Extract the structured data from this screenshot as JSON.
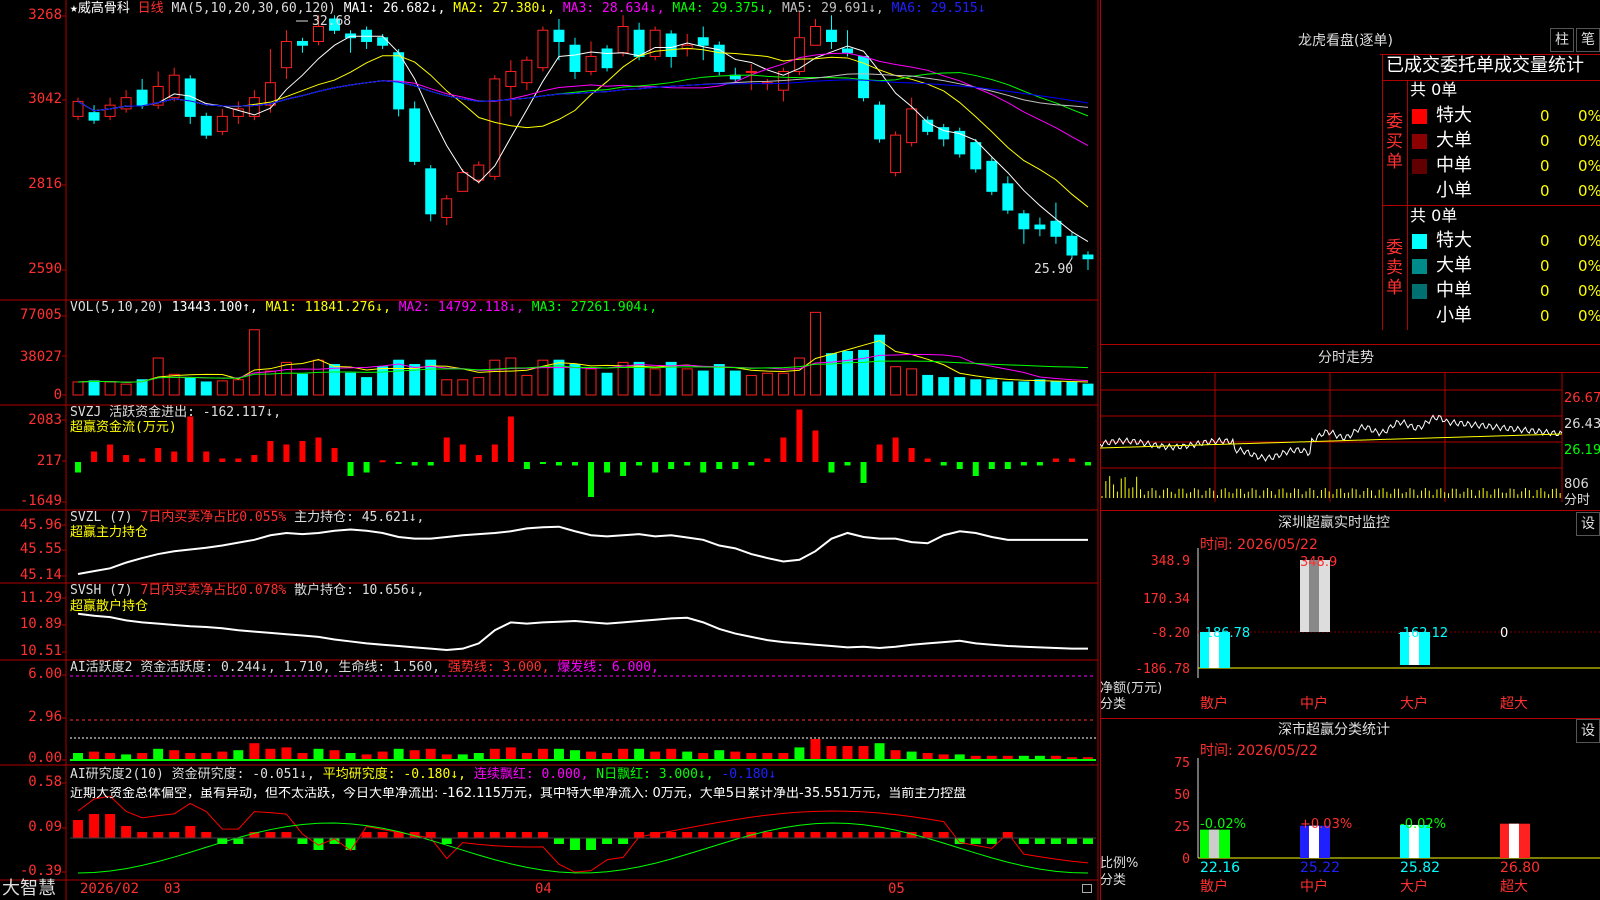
{
  "colors": {
    "up": "#ff2020",
    "down": "#00ffff",
    "ma1": "#ffffff",
    "ma2": "#ffff00",
    "ma3": "#ff00ff",
    "ma4": "#00ff00",
    "ma5": "#c0c0c0",
    "ma6": "#0000ff",
    "green": "#00ff00",
    "grid": "#b00000"
  },
  "main": {
    "title": "★威高骨科",
    "period": "日线",
    "ma_label": "MA(5,10,20,30,60,120)",
    "ma_items": [
      {
        "text": "MA1: 26.682↓,",
        "color": "#ffffff"
      },
      {
        "text": "MA2: 27.380↓,",
        "color": "#ffff00"
      },
      {
        "text": "MA3: 28.634↓,",
        "color": "#ff00ff"
      },
      {
        "text": "MA4: 29.375↓,",
        "color": "#00ff00"
      },
      {
        "text": "MA5: 29.691↓,",
        "color": "#c0c0c0"
      },
      {
        "text": "MA6: 29.515↓",
        "color": "#2020ff"
      }
    ],
    "axis": [
      "3268",
      "3042",
      "2816",
      "2590"
    ],
    "high_label": "32.68",
    "low_label": "25.90"
  },
  "chart_data": {
    "type": "candlestick",
    "candles": [
      [
        30.0,
        30.4,
        29.9,
        30.5
      ],
      [
        30.1,
        29.9,
        29.8,
        30.3
      ],
      [
        30.0,
        30.3,
        29.9,
        30.5
      ],
      [
        30.2,
        30.5,
        30.1,
        30.7
      ],
      [
        30.7,
        30.3,
        30.2,
        31.0
      ],
      [
        30.3,
        30.8,
        30.2,
        31.2
      ],
      [
        30.5,
        31.1,
        30.4,
        31.3
      ],
      [
        31.0,
        30.0,
        29.8,
        31.1
      ],
      [
        30.0,
        29.5,
        29.4,
        30.1
      ],
      [
        29.6,
        30.0,
        29.5,
        30.2
      ],
      [
        30.0,
        30.2,
        29.8,
        30.4
      ],
      [
        30.0,
        30.5,
        29.9,
        30.7
      ],
      [
        30.3,
        30.9,
        30.1,
        31.8
      ],
      [
        31.3,
        32.0,
        31.0,
        32.3
      ],
      [
        32.0,
        31.9,
        31.7,
        32.1
      ],
      [
        32.0,
        32.4,
        31.9,
        32.7
      ],
      [
        32.6,
        32.3,
        32.2,
        32.7
      ],
      [
        32.2,
        32.1,
        31.7,
        32.3
      ],
      [
        32.3,
        32.0,
        31.8,
        32.4
      ],
      [
        32.1,
        31.9,
        31.8,
        32.2
      ],
      [
        31.7,
        30.2,
        30.0,
        31.8
      ],
      [
        30.2,
        28.8,
        28.7,
        30.4
      ],
      [
        28.6,
        27.4,
        27.2,
        28.7
      ],
      [
        27.3,
        27.8,
        27.1,
        27.9
      ],
      [
        28.0,
        28.5,
        28.0,
        28.6
      ],
      [
        28.3,
        28.7,
        28.2,
        28.8
      ],
      [
        28.4,
        31.0,
        28.3,
        31.1
      ],
      [
        30.8,
        31.2,
        30.0,
        31.5
      ],
      [
        30.9,
        31.5,
        30.7,
        31.6
      ],
      [
        31.3,
        32.3,
        31.2,
        32.4
      ],
      [
        32.3,
        32.0,
        31.5,
        32.6
      ],
      [
        31.9,
        31.2,
        31.0,
        32.1
      ],
      [
        31.2,
        31.6,
        31.1,
        32.0
      ],
      [
        31.8,
        31.3,
        31.2,
        31.9
      ],
      [
        31.7,
        32.4,
        31.6,
        32.7
      ],
      [
        32.3,
        31.6,
        31.5,
        32.5
      ],
      [
        31.6,
        32.3,
        31.5,
        32.4
      ],
      [
        32.2,
        31.6,
        31.3,
        32.3
      ],
      [
        31.8,
        31.9,
        31.6,
        32.2
      ],
      [
        32.1,
        31.9,
        31.5,
        32.4
      ],
      [
        31.9,
        31.2,
        31.1,
        32.0
      ],
      [
        31.1,
        31.0,
        30.9,
        31.3
      ],
      [
        31.2,
        31.2,
        30.7,
        31.4
      ],
      [
        30.9,
        30.9,
        30.7,
        31.0
      ],
      [
        30.7,
        31.2,
        30.4,
        31.3
      ],
      [
        31.2,
        32.1,
        31.1,
        32.8
      ],
      [
        31.9,
        32.4,
        31.9,
        32.6
      ],
      [
        32.3,
        32.0,
        31.8,
        32.7
      ],
      [
        31.8,
        31.7,
        31.6,
        32.3
      ],
      [
        31.6,
        30.5,
        30.4,
        31.0
      ],
      [
        30.3,
        29.4,
        29.3,
        30.4
      ],
      [
        28.5,
        29.5,
        28.4,
        29.6
      ],
      [
        29.3,
        30.2,
        29.2,
        30.5
      ],
      [
        29.9,
        29.6,
        29.5,
        30.0
      ],
      [
        29.7,
        29.4,
        29.2,
        29.8
      ],
      [
        29.6,
        29.0,
        28.9,
        29.7
      ],
      [
        29.3,
        28.6,
        28.5,
        29.4
      ],
      [
        28.8,
        28.0,
        27.9,
        28.9
      ],
      [
        28.2,
        27.5,
        27.4,
        28.4
      ],
      [
        27.4,
        27.0,
        26.6,
        27.5
      ],
      [
        27.1,
        27.0,
        26.8,
        27.3
      ],
      [
        27.2,
        26.8,
        26.6,
        27.7
      ],
      [
        26.8,
        26.3,
        26.2,
        26.9
      ],
      [
        26.3,
        26.2,
        25.9,
        26.4
      ]
    ],
    "volumes": [
      1.2,
      1.3,
      1.2,
      1.0,
      1.4,
      3.4,
      1.9,
      1.6,
      1.2,
      1.3,
      1.4,
      6.0,
      2.2,
      3.0,
      1.9,
      3.2,
      2.8,
      2.0,
      1.6,
      2.6,
      3.2,
      2.8,
      3.2,
      1.4,
      1.4,
      1.6,
      3.2,
      3.4,
      1.8,
      3.2,
      3.2,
      2.8,
      2.4,
      2.0,
      3.0,
      3.0,
      2.4,
      3.0,
      2.4,
      2.2,
      2.8,
      2.2,
      1.8,
      2.0,
      2.0,
      3.4,
      7.6,
      3.8,
      4.0,
      4.1,
      5.5,
      2.6,
      2.4,
      1.8,
      1.6,
      1.6,
      1.4,
      1.4,
      1.2,
      1.2,
      1.4,
      1.2,
      1.2,
      1.0
    ],
    "volume_axis": [
      "77005",
      "38027",
      "0"
    ],
    "svzj": [
      -0.3,
      0.3,
      0.5,
      0.2,
      0.1,
      0.4,
      0.3,
      1.3,
      0.3,
      0.1,
      0.1,
      0.2,
      0.6,
      0.5,
      0.6,
      0.7,
      0.4,
      -0.4,
      -0.3,
      0.05,
      -0.05,
      -0.1,
      -0.1,
      0.7,
      0.5,
      0.2,
      0.5,
      1.3,
      -0.2,
      -0.05,
      -0.1,
      -0.1,
      -1.0,
      -0.3,
      -0.4,
      -0.1,
      -0.3,
      -0.2,
      -0.1,
      -0.3,
      -0.2,
      -0.2,
      -0.1,
      0.1,
      0.7,
      1.5,
      0.9,
      -0.3,
      -0.1,
      -0.6,
      0.5,
      0.7,
      0.4,
      0.1,
      -0.1,
      -0.2,
      -0.4,
      -0.2,
      -0.2,
      -0.1,
      -0.1,
      0.1,
      0.1,
      -0.1
    ],
    "svzj_axis": [
      "2083",
      "217",
      "-1649"
    ],
    "svzl": [
      45.1,
      45.15,
      45.2,
      45.3,
      45.38,
      45.45,
      45.5,
      45.53,
      45.56,
      45.6,
      45.65,
      45.7,
      45.78,
      45.82,
      45.8,
      45.82,
      45.86,
      45.88,
      45.86,
      45.82,
      45.75,
      45.72,
      45.72,
      45.75,
      45.78,
      45.8,
      45.82,
      45.85,
      45.9,
      45.92,
      45.93,
      45.85,
      45.78,
      45.76,
      45.78,
      45.8,
      45.76,
      45.78,
      45.74,
      45.7,
      45.6,
      45.55,
      45.45,
      45.38,
      45.32,
      45.35,
      45.5,
      45.72,
      45.82,
      45.75,
      45.72,
      45.72,
      45.66,
      45.64,
      45.78,
      45.85,
      45.82,
      45.75,
      45.7,
      45.7,
      45.7,
      45.7,
      45.7,
      45.7
    ],
    "svzl_axis": [
      "45.96",
      "45.55",
      "45.14"
    ],
    "svsh": [
      11.05,
      11.02,
      11.0,
      10.95,
      10.92,
      10.9,
      10.88,
      10.86,
      10.85,
      10.83,
      10.8,
      10.78,
      10.76,
      10.74,
      10.72,
      10.7,
      10.66,
      10.63,
      10.6,
      10.58,
      10.56,
      10.54,
      10.52,
      10.5,
      10.52,
      10.6,
      10.8,
      10.92,
      10.9,
      10.92,
      10.93,
      10.94,
      10.92,
      10.9,
      10.92,
      10.94,
      10.96,
      10.98,
      10.99,
      10.92,
      10.82,
      10.75,
      10.7,
      10.65,
      10.62,
      10.6,
      10.58,
      10.56,
      10.54,
      10.55,
      10.53,
      10.55,
      10.58,
      10.6,
      10.62,
      10.64,
      10.6,
      10.58,
      10.56,
      10.55,
      10.54,
      10.53,
      10.52,
      10.52
    ],
    "svsh_axis": [
      "11.29",
      "10.89",
      "10.51"
    ],
    "ai_active": [
      0.5,
      0.6,
      0.5,
      0.4,
      0.5,
      0.8,
      0.7,
      0.5,
      0.5,
      0.6,
      0.7,
      1.2,
      0.8,
      0.9,
      0.5,
      0.8,
      0.7,
      0.5,
      0.4,
      0.6,
      0.8,
      0.7,
      0.8,
      0.4,
      0.4,
      0.5,
      0.8,
      0.9,
      0.5,
      0.8,
      0.8,
      0.7,
      0.6,
      0.5,
      0.8,
      0.8,
      0.6,
      0.8,
      0.6,
      0.5,
      0.7,
      0.6,
      0.5,
      0.5,
      0.5,
      0.9,
      1.5,
      1.0,
      1.0,
      1.0,
      1.2,
      0.7,
      0.6,
      0.5,
      0.4,
      0.4,
      0.3,
      0.3,
      0.3,
      0.3,
      0.3,
      0.3,
      0.2,
      0.2
    ],
    "ai_axis": [
      "6.00",
      "2.96",
      "0.00"
    ],
    "ai_research": [
      0.3,
      0.4,
      0.4,
      0.2,
      0.1,
      0.1,
      0.1,
      0.2,
      0.1,
      -0.1,
      -0.1,
      0.1,
      0.1,
      0.1,
      -0.1,
      -0.2,
      -0.1,
      -0.2,
      0.1,
      0.1,
      0.1,
      0.1,
      0.1,
      -0.1,
      0.1,
      0.1,
      0.1,
      0.1,
      0.1,
      0.1,
      -0.1,
      -0.2,
      -0.2,
      -0.1,
      -0.1,
      0.1,
      0.1,
      0.1,
      0.1,
      0.1,
      0.1,
      0.1,
      0.1,
      0.1,
      0.1,
      0.1,
      0.1,
      0.1,
      0.1,
      0.1,
      0.1,
      0.1,
      0.1,
      0.1,
      0.1,
      -0.1,
      -0.1,
      -0.1,
      0.1,
      -0.1,
      -0.1,
      -0.1,
      -0.1,
      -0.1
    ],
    "ai_research_axis": [
      "0.58",
      "0.09",
      "-0.39"
    ]
  },
  "panels": {
    "vol": {
      "label": "VOL(5,10,20)",
      "value": "13443.100↑,",
      "items": [
        {
          "text": "MA1: 11841.276↓,",
          "color": "#ffff00"
        },
        {
          "text": "MA2: 14792.118↓,",
          "color": "#ff00ff"
        },
        {
          "text": "MA3: 27261.904↓,",
          "color": "#00ff00"
        }
      ]
    },
    "svzj": {
      "label": "SVZJ  活跃资金进出: -162.117↓,",
      "sub": "超赢资金流(万元)"
    },
    "svzl": {
      "label": "SVZL (7)",
      "pct": "7日内买卖净占比0.055%",
      "hold": "主力持仓: 45.621↓,",
      "sub": "超赢主力持仓"
    },
    "svsh": {
      "label": "SVSH (7)",
      "pct": "7日内买卖净占比0.078%",
      "hold": "散户持仓: 10.656↓,",
      "sub": "超赢散户持仓"
    },
    "ai2": {
      "label": "AI活跃度2 资金活跃度: 0.244↓, 1.710, 生命线: 1.560,",
      "strong": "强势线: 3.000,",
      "burst": "爆发线: 6.000,"
    },
    "ai_r": {
      "label": "AI研究度2(10) 资金研究度: -0.051↓,",
      "avg": "平均研究度: -0.180↓,",
      "cont": "连续飘红: 0.000,",
      "n": "N日飘红: 3.000↓,",
      "last": "-0.180↓",
      "comment": "近期大资金总体偏空，虽有异动，但不太活跃，今日大单净流出: -162.115万元，其中特大单净流入: 0万元，大单5日累计净出-35.551万元，当前主力控盘"
    }
  },
  "bottom": {
    "brand": "大智慧",
    "dates": [
      "2026/02",
      "03",
      "04",
      "05"
    ]
  },
  "right": {
    "lhb": {
      "title": "龙虎看盘(逐单)",
      "btn1": "柱",
      "btn2": "笔",
      "tabs": "已成交委托单成交量统计",
      "buy_side": "委买单",
      "sell_side": "委卖单",
      "buy_total": "共 0单",
      "sell_total": "共 0单",
      "buy_rows": [
        {
          "name": "特大",
          "count": "0",
          "pct": "0%",
          "color": "#ff0000"
        },
        {
          "name": "大单",
          "count": "0",
          "pct": "0%",
          "color": "#8b0000"
        },
        {
          "name": "中单",
          "count": "0",
          "pct": "0%",
          "color": "#600000"
        },
        {
          "name": "小单",
          "count": "0",
          "pct": "0%",
          "color": "#000000"
        }
      ],
      "sell_rows": [
        {
          "name": "特大",
          "count": "0",
          "pct": "0%",
          "color": "#00ffff"
        },
        {
          "name": "大单",
          "count": "0",
          "pct": "0%",
          "color": "#008b8b"
        },
        {
          "name": "中单",
          "count": "0",
          "pct": "0%",
          "color": "#007070"
        },
        {
          "name": "小单",
          "count": "0",
          "pct": "0%",
          "color": "#000000"
        }
      ]
    },
    "fs": {
      "title": "分时走势",
      "axis": [
        "26.67",
        "26.43",
        "26.19"
      ],
      "vol_label": "806",
      "vol_unit": "分时"
    },
    "monitor": {
      "title": "深圳超赢实时监控",
      "btn": "设",
      "time": "时间: 2026/05/22",
      "axis": [
        "348.9",
        "170.34",
        "-8.20",
        "-186.78"
      ],
      "bars": [
        {
          "label": "散户",
          "value": "-186.78"
        },
        {
          "label": "中户",
          "value": "348.9"
        },
        {
          "label": "大户",
          "value": "-162.12"
        },
        {
          "label": "超大",
          "value": "0"
        }
      ],
      "ylabel": "净额(万元)",
      "xlabel": "分类"
    },
    "classify": {
      "title": "深市超赢分类统计",
      "btn": "设",
      "time": "时间: 2026/05/22",
      "axis": [
        "75",
        "50",
        "25",
        "0"
      ],
      "bars": [
        {
          "label": "散户",
          "pct": "-0.02%",
          "val": "22.16"
        },
        {
          "label": "中户",
          "pct": "+0.03%",
          "val": "25.22"
        },
        {
          "label": "大户",
          "pct": "-0.02%",
          "val": "25.82"
        },
        {
          "label": "超大",
          "pct": "",
          "val": "26.80"
        }
      ],
      "ylabel": "比例%",
      "xlabel": "分类"
    }
  }
}
